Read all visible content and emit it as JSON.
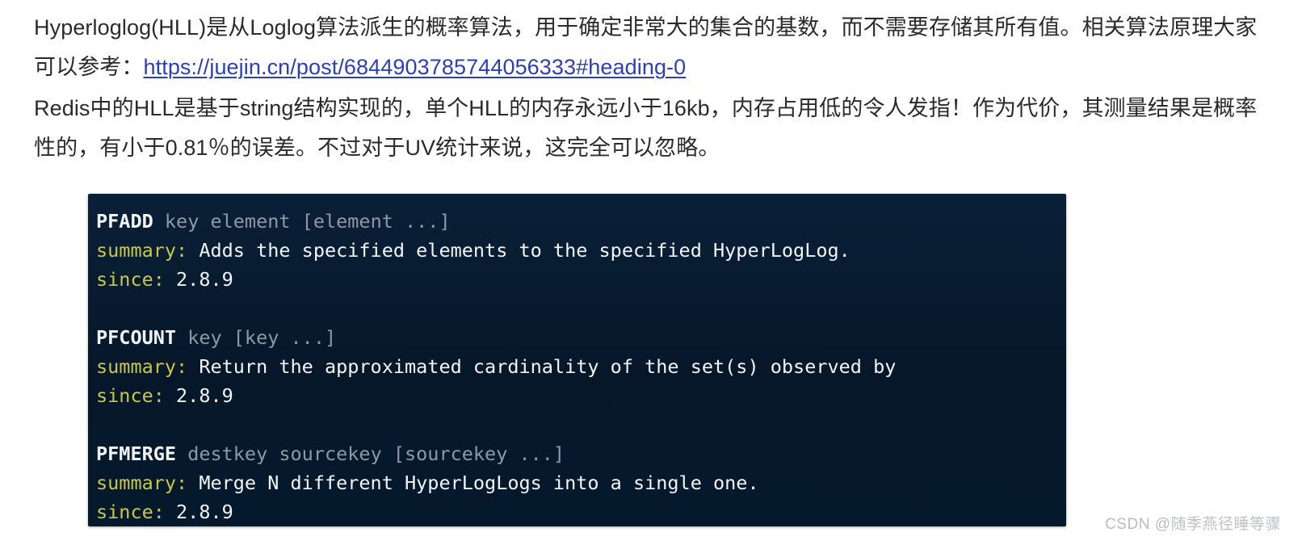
{
  "article": {
    "paragraphs": [
      {
        "id": "p1",
        "lead": "Hyperloglog(HLL)是从Loglog算法派生的概率算法，用于确定非常大的集合的基数，而不需要存储其所有值。相关算法原理大家可以参考：",
        "link_text": "https://juejin.cn/post/6844903785744056333#heading-0"
      },
      {
        "id": "p2",
        "text": "Redis中的HLL是基于string结构实现的，单个HLL的内存永远小于16kb，内存占用低的令人发指！作为代价，其测量结果是概率性的，有小于0.81％的误差。不过对于UV统计来说，这完全可以忽略。"
      }
    ]
  },
  "code_block": {
    "background_color": "#071a2e",
    "command_color": "#f2f5f8",
    "argument_color": "#8b9aa6",
    "label_color": "#c7c84a",
    "text_color": "#f2f5f8",
    "entries": [
      {
        "command": "PFADD",
        "arguments": " key element [element ...]",
        "summary_label": "summary:",
        "summary_text": " Adds the specified elements to the specified HyperLogLog.",
        "since_label": "since:",
        "since_text": " 2.8.9"
      },
      {
        "command": "PFCOUNT",
        "arguments": " key [key ...]",
        "summary_label": "summary:",
        "summary_text": " Return the approximated cardinality of the set(s) observed by",
        "since_label": "since:",
        "since_text": " 2.8.9"
      },
      {
        "command": "PFMERGE",
        "arguments": " destkey sourcekey [sourcekey ...]",
        "summary_label": "summary:",
        "summary_text": " Merge N different HyperLogLogs into a single one.",
        "since_label": "since:",
        "since_text": " 2.8.9"
      }
    ]
  },
  "watermark": {
    "prefix": "CSDN @",
    "username": "随季燕径睡等骤"
  }
}
